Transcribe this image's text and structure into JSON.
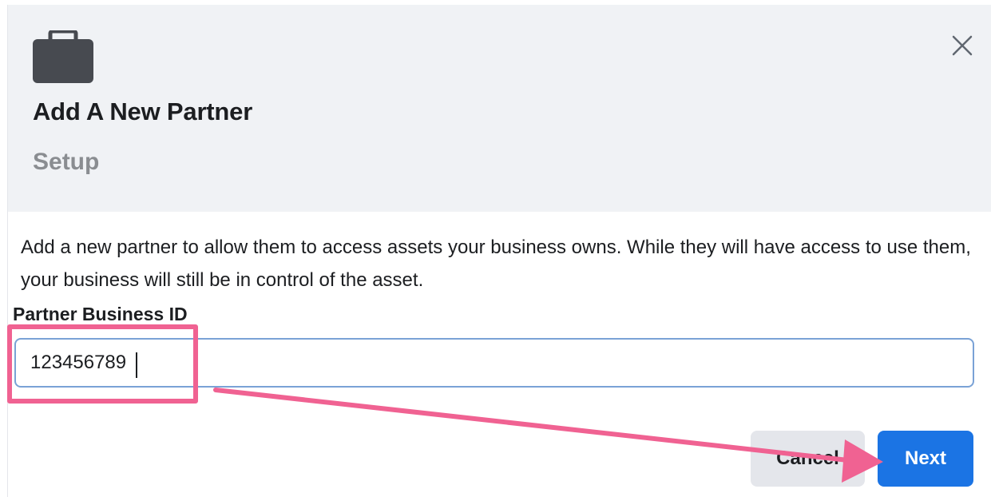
{
  "dialog": {
    "header": {
      "icon": "briefcase-icon",
      "title": "Add A New Partner",
      "subtitle": "Setup",
      "close_icon": "close-icon"
    },
    "description": "Add a new partner to allow them to access assets your business owns. While they will have access to use them, your business will still be in control of the asset.",
    "field": {
      "label": "Partner Business ID",
      "value": "123456789",
      "placeholder": ""
    },
    "buttons": {
      "cancel_label": "Cancel",
      "next_label": "Next"
    }
  },
  "annotation": {
    "color": "#f06292",
    "shape": "highlight-box-and-arrow"
  },
  "colors": {
    "header_bg": "#f0f2f5",
    "primary": "#1b74e4",
    "secondary_button": "#e4e6eb",
    "subtitle": "#8a8d91",
    "input_border": "#7aa2d6"
  }
}
